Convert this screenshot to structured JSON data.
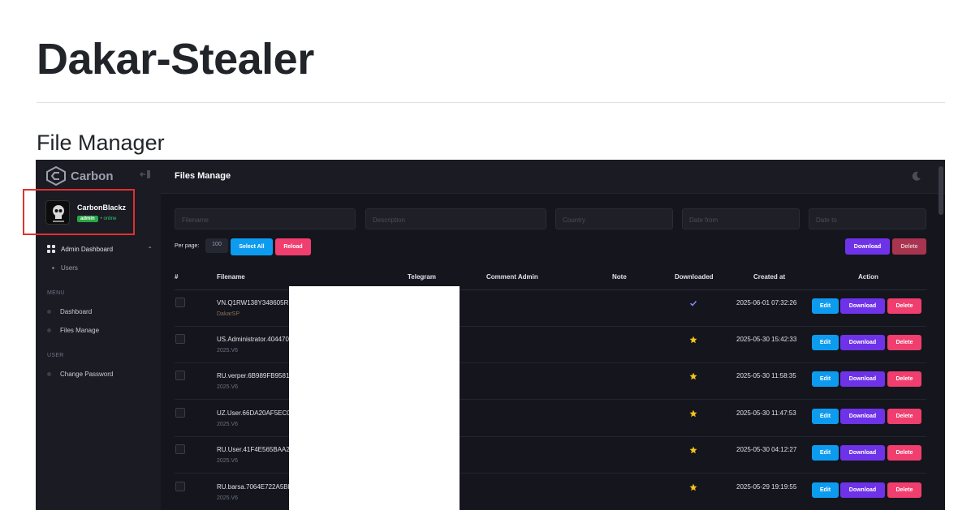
{
  "document": {
    "title": "Dakar-Stealer",
    "subtitle": "File Manager"
  },
  "sidebar": {
    "brand": "Carbon",
    "user": {
      "name": "CarbonBlackz",
      "role": "admin",
      "status": "• online"
    },
    "admin_dashboard": "Admin Dashboard",
    "admin_sub": "Users",
    "sections": {
      "menu": "MENU",
      "user": "USER"
    },
    "menu_items": [
      "Dashboard",
      "Files Manage"
    ],
    "user_items": [
      "Change Password"
    ]
  },
  "header": {
    "title": "Files Manage"
  },
  "filters": {
    "filename": "Filename",
    "description": "Description",
    "country": "Country",
    "date_from": "Date from",
    "date_to": "Date to"
  },
  "toolbar": {
    "per_page_label": "Per page:",
    "per_page_value": "100",
    "select_all": "Select All",
    "reload": "Reload",
    "download": "Download",
    "delete": "Delete"
  },
  "table": {
    "columns": [
      "#",
      "Filename",
      "Telegram",
      "Comment Admin",
      "Note",
      "Downloaded",
      "Created at",
      "Action"
    ],
    "action_labels": {
      "edit": "Edit",
      "download": "Download",
      "delete": "Delete"
    },
    "rows": [
      {
        "filename": "VN.Q1RW138Y348605RE",
        "sub": "DakarSP",
        "downloaded": "check",
        "created": "2025-06-01 07:32:26"
      },
      {
        "filename": "US.Administrator.404470",
        "sub": "2025.V6",
        "downloaded": "star",
        "created": "2025-05-30 15:42:33"
      },
      {
        "filename": "RU.verper.6B989FB9581",
        "sub": "2025.V6",
        "downloaded": "star",
        "created": "2025-05-30 11:58:35"
      },
      {
        "filename": "UZ.User.66DA20AF5EC0",
        "sub": "2025.V6",
        "downloaded": "star",
        "created": "2025-05-30 11:47:53"
      },
      {
        "filename": "RU.User.41F4E565BAA2",
        "sub": "2025.V6",
        "downloaded": "star",
        "created": "2025-05-30 04:12:27"
      },
      {
        "filename": "RU.barsa.7064E722A5BF",
        "sub": "2025.V6",
        "downloaded": "star",
        "created": "2025-05-29 19:19:55"
      }
    ]
  },
  "colors": {
    "accent_blue": "#0d9bf0",
    "accent_purple": "#6e32e8",
    "accent_red": "#f03e6e",
    "star": "#f5c518",
    "check": "#7c8cf8",
    "highlight": "#e03131"
  }
}
